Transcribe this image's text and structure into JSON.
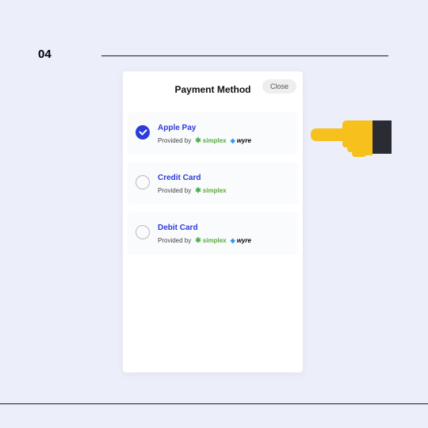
{
  "step": "04",
  "modal": {
    "title": "Payment Method",
    "close_label": "Close"
  },
  "options": [
    {
      "title": "Apple Pay",
      "provided_label": "Provided by",
      "providers": {
        "simplex": "simplex",
        "wyre": "wyre"
      },
      "selected": true
    },
    {
      "title": "Credit Card",
      "provided_label": "Provided by",
      "providers": {
        "simplex": "simplex"
      },
      "selected": false
    },
    {
      "title": "Debit Card",
      "provided_label": "Provided by",
      "providers": {
        "simplex": "simplex",
        "wyre": "wyre"
      },
      "selected": false
    }
  ]
}
